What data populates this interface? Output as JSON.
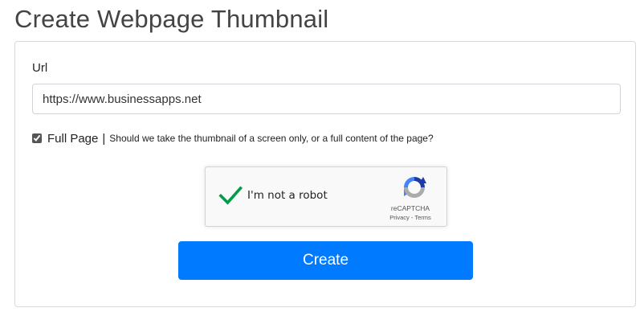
{
  "page": {
    "title": "Create Webpage Thumbnail"
  },
  "form": {
    "url_label": "Url",
    "url_value": "https://www.businessapps.net",
    "full_page_label": "Full Page",
    "full_page_separator": "|",
    "full_page_checked": true,
    "full_page_help": "Should we take the thumbnail of a screen only, or a full content of the page?",
    "create_label": "Create"
  },
  "recaptcha": {
    "label": "I'm not a robot",
    "checked": true,
    "brand": "reCAPTCHA",
    "privacy": "Privacy",
    "link_separator": " - ",
    "terms": "Terms",
    "check_icon": "check-icon",
    "logo_icon": "recaptcha-logo-icon"
  },
  "colors": {
    "primary": "#007bff",
    "check_green": "#009c4a",
    "recaptcha_blue": "#1c3aa9",
    "recaptcha_light_blue": "#4285f4",
    "recaptcha_gray": "#ababab"
  }
}
